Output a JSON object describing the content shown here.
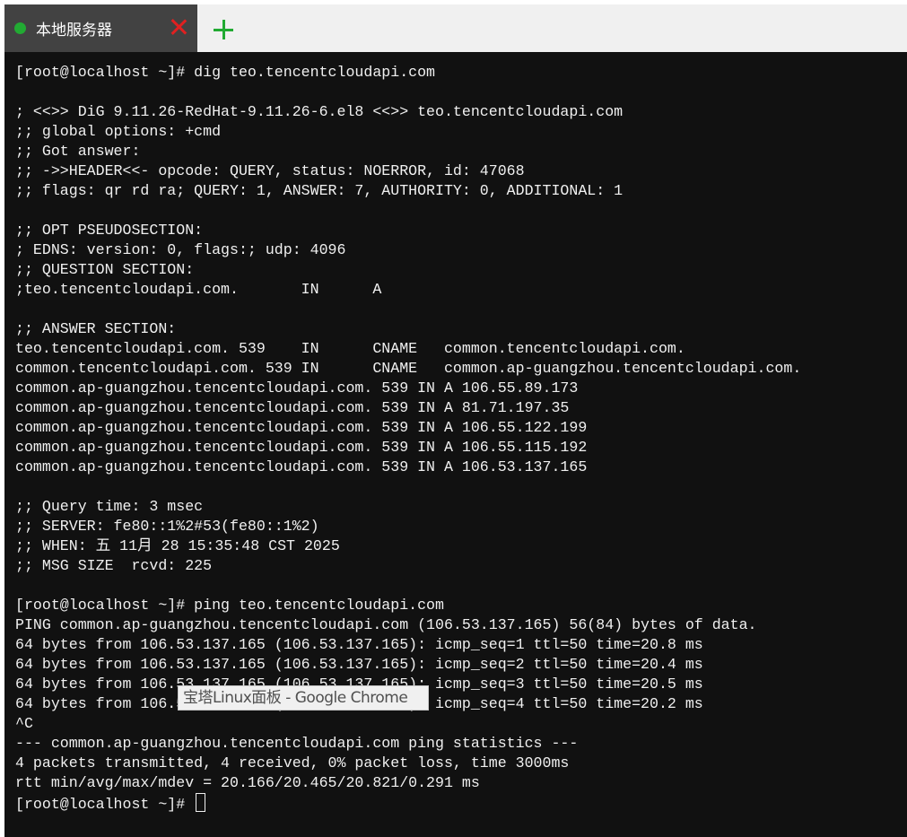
{
  "colors": {
    "status_dot": "#22aa33",
    "close": "#e02020",
    "add": "#22aa33"
  },
  "tabbar": {
    "tab_label": "本地服务器",
    "status_icon": "green-dot-icon",
    "close_icon": "close-icon",
    "add_icon": "plus-icon"
  },
  "terminal": {
    "lines": [
      "[root@localhost ~]# dig teo.tencentcloudapi.com",
      "",
      "; <<>> DiG 9.11.26-RedHat-9.11.26-6.el8 <<>> teo.tencentcloudapi.com",
      ";; global options: +cmd",
      ";; Got answer:",
      ";; ->>HEADER<<- opcode: QUERY, status: NOERROR, id: 47068",
      ";; flags: qr rd ra; QUERY: 1, ANSWER: 7, AUTHORITY: 0, ADDITIONAL: 1",
      "",
      ";; OPT PSEUDOSECTION:",
      "; EDNS: version: 0, flags:; udp: 4096",
      ";; QUESTION SECTION:",
      ";teo.tencentcloudapi.com.       IN      A",
      "",
      ";; ANSWER SECTION:",
      "teo.tencentcloudapi.com. 539    IN      CNAME   common.tencentcloudapi.com.",
      "common.tencentcloudapi.com. 539 IN      CNAME   common.ap-guangzhou.tencentcloudapi.com.",
      "common.ap-guangzhou.tencentcloudapi.com. 539 IN A 106.55.89.173",
      "common.ap-guangzhou.tencentcloudapi.com. 539 IN A 81.71.197.35",
      "common.ap-guangzhou.tencentcloudapi.com. 539 IN A 106.55.122.199",
      "common.ap-guangzhou.tencentcloudapi.com. 539 IN A 106.55.115.192",
      "common.ap-guangzhou.tencentcloudapi.com. 539 IN A 106.53.137.165",
      "",
      ";; Query time: 3 msec",
      ";; SERVER: fe80::1%2#53(fe80::1%2)",
      ";; WHEN: 五 11月 28 15:35:48 CST 2025",
      ";; MSG SIZE  rcvd: 225",
      "",
      "[root@localhost ~]# ping teo.tencentcloudapi.com",
      "PING common.ap-guangzhou.tencentcloudapi.com (106.53.137.165) 56(84) bytes of data.",
      "64 bytes from 106.53.137.165 (106.53.137.165): icmp_seq=1 ttl=50 time=20.8 ms",
      "64 bytes from 106.53.137.165 (106.53.137.165): icmp_seq=2 ttl=50 time=20.4 ms",
      "64 bytes from 106.53.137.165 (106.53.137.165): icmp_seq=3 ttl=50 time=20.5 ms",
      "64 bytes from 106.53.137.165 (106.53.137.165): icmp_seq=4 ttl=50 time=20.2 ms",
      "^C",
      "--- common.ap-guangzhou.tencentcloudapi.com ping statistics ---",
      "4 packets transmitted, 4 received, 0% packet loss, time 3000ms",
      "rtt min/avg/max/mdev = 20.166/20.465/20.821/0.291 ms"
    ],
    "prompt": "[root@localhost ~]# "
  },
  "tooltip": {
    "text": "宝塔Linux面板 - Google Chrome"
  }
}
